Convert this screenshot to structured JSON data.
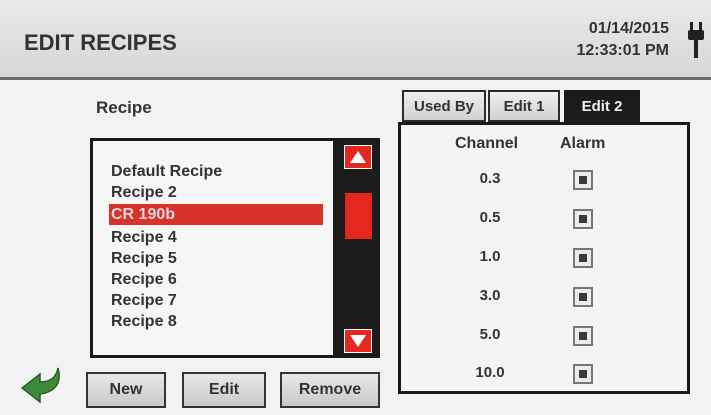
{
  "header": {
    "title": "EDIT RECIPES",
    "date": "01/14/2015",
    "time": "12:33:01 PM",
    "power_icon": "plug-icon"
  },
  "recipe_section": {
    "label": "Recipe",
    "items": [
      {
        "label": "Default Recipe",
        "selected": false
      },
      {
        "label": "Recipe 2",
        "selected": false
      },
      {
        "label": "CR 190b",
        "selected": true
      },
      {
        "label": "Recipe 4",
        "selected": false
      },
      {
        "label": "Recipe 5",
        "selected": false
      },
      {
        "label": "Recipe 6",
        "selected": false
      },
      {
        "label": "Recipe 7",
        "selected": false
      },
      {
        "label": "Recipe 8",
        "selected": false
      }
    ]
  },
  "buttons": {
    "new": "New",
    "edit": "Edit",
    "remove": "Remove"
  },
  "tabs": [
    {
      "label": "Used By",
      "active": false
    },
    {
      "label": "Edit 1",
      "active": false
    },
    {
      "label": "Edit 2",
      "active": true
    }
  ],
  "channel_table": {
    "channel_header": "Channel",
    "alarm_header": "Alarm",
    "rows": [
      {
        "channel": "0.3",
        "alarm": true
      },
      {
        "channel": "0.5",
        "alarm": true
      },
      {
        "channel": "1.0",
        "alarm": true
      },
      {
        "channel": "3.0",
        "alarm": true
      },
      {
        "channel": "5.0",
        "alarm": true
      },
      {
        "channel": "10.0",
        "alarm": true
      }
    ]
  },
  "colors": {
    "accent_red": "#e5281f",
    "selection_red": "#d7332b",
    "back_arrow_green": "#3d8a3a"
  }
}
